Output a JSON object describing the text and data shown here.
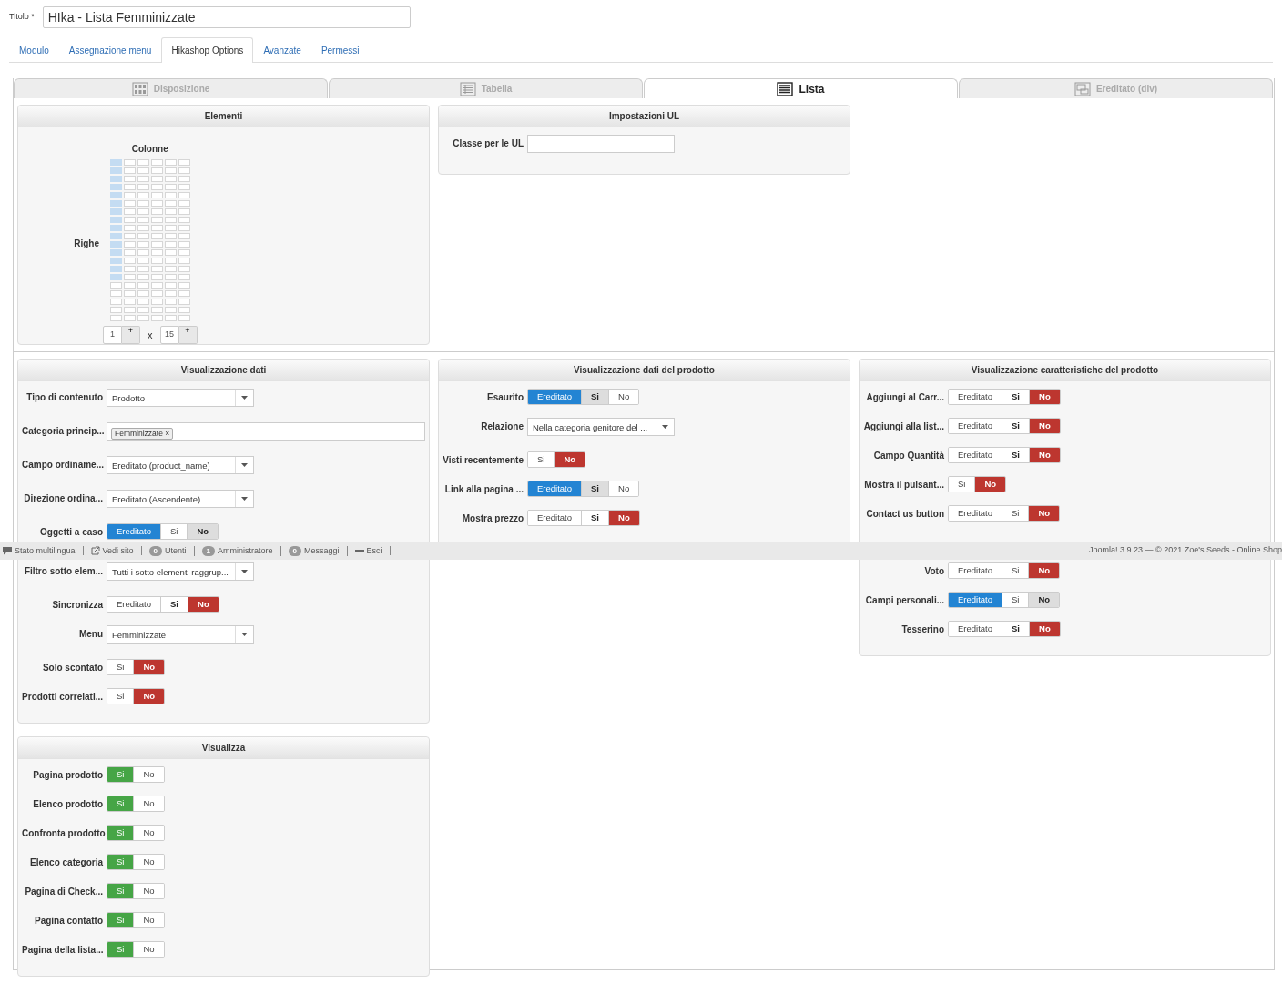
{
  "title_field": {
    "label": "Titolo *",
    "value": "HIka - Lista Femminizzate"
  },
  "tabs": [
    {
      "label": "Modulo",
      "selected": false
    },
    {
      "label": "Assegnazione menu",
      "selected": false
    },
    {
      "label": "Hikashop Options",
      "selected": true
    },
    {
      "label": "Avanzate",
      "selected": false
    },
    {
      "label": "Permessi",
      "selected": false
    }
  ],
  "layout_tabs": [
    {
      "label": "Disposizione",
      "kind": "grid",
      "selected": false
    },
    {
      "label": "Tabella",
      "kind": "table",
      "selected": false
    },
    {
      "label": "Lista",
      "kind": "list",
      "selected": true
    },
    {
      "label": "Ereditato (div)",
      "kind": "div",
      "selected": false
    }
  ],
  "elements_panel": {
    "title": "Elementi",
    "columns_label": "Colonne",
    "rows_label": "Righe",
    "columns": "1",
    "rows": "15",
    "times": "x",
    "increment": "+",
    "decrement": "–"
  },
  "ul_panel": {
    "title": "Impostazioni UL",
    "fields": [
      {
        "label": "Classe per le UL",
        "kind": "text"
      }
    ]
  },
  "data_panel": {
    "title": "Visualizzazione dati",
    "fields": [
      {
        "label": "Tipo di contenuto",
        "kind": "select",
        "value": "Prodotto"
      },
      {
        "label": "Categoria princip...",
        "kind": "tags",
        "tags": [
          {
            "label": "Femminizzate",
            "remove": "×"
          }
        ]
      },
      {
        "label": "Campo ordiname...",
        "kind": "select",
        "value": "Ereditato (product_name)"
      },
      {
        "label": "Direzione ordina...",
        "kind": "select",
        "value": "Ereditato (Ascendente)"
      },
      {
        "label": "Oggetti a caso",
        "kind": "toggle",
        "options": [
          {
            "label": "Ereditato",
            "kind": "inherit",
            "selected": true,
            "default": false
          },
          {
            "label": "Si",
            "kind": "yes",
            "selected": false,
            "default": false
          },
          {
            "label": "No",
            "kind": "no",
            "selected": false,
            "default": true
          }
        ]
      },
      {
        "label": "Filtro sotto elem...",
        "kind": "select",
        "value": "Tutti i sotto elementi raggrup..."
      },
      {
        "label": "Sincronizza",
        "kind": "toggle",
        "options": [
          {
            "label": "Ereditato",
            "kind": "inherit",
            "selected": false,
            "default": false
          },
          {
            "label": "Si",
            "kind": "yes",
            "selected": false,
            "default": true
          },
          {
            "label": "No",
            "kind": "no",
            "selected": true,
            "default": false
          }
        ]
      },
      {
        "label": "Menu",
        "kind": "select",
        "value": "Femminizzate"
      },
      {
        "label": "Solo scontato",
        "kind": "toggle",
        "options": [
          {
            "label": "Si",
            "kind": "yes",
            "selected": false,
            "default": false
          },
          {
            "label": "No",
            "kind": "no",
            "selected": true,
            "default": false
          }
        ]
      },
      {
        "label": "Prodotti correlati...",
        "kind": "toggle",
        "options": [
          {
            "label": "Si",
            "kind": "yes",
            "selected": false,
            "default": false
          },
          {
            "label": "No",
            "kind": "no",
            "selected": true,
            "default": false
          }
        ]
      }
    ]
  },
  "product_data_panel": {
    "title": "Visualizzazione dati del prodotto",
    "fields": [
      {
        "label": "Esaurito",
        "kind": "toggle",
        "options": [
          {
            "label": "Ereditato",
            "kind": "inherit",
            "selected": true,
            "default": false
          },
          {
            "label": "Si",
            "kind": "yes",
            "selected": false,
            "default": true
          },
          {
            "label": "No",
            "kind": "no",
            "selected": false,
            "default": false
          }
        ]
      },
      {
        "label": "Relazione",
        "kind": "select",
        "value": "Nella categoria genitore del ..."
      },
      {
        "label": "Visti recentemente",
        "kind": "toggle",
        "options": [
          {
            "label": "Si",
            "kind": "yes",
            "selected": false,
            "default": false
          },
          {
            "label": "No",
            "kind": "no",
            "selected": true,
            "default": false
          }
        ]
      },
      {
        "label": "Link alla pagina ...",
        "kind": "toggle",
        "options": [
          {
            "label": "Ereditato",
            "kind": "inherit",
            "selected": true,
            "default": false
          },
          {
            "label": "Si",
            "kind": "yes",
            "selected": false,
            "default": true
          },
          {
            "label": "No",
            "kind": "no",
            "selected": false,
            "default": false
          }
        ]
      },
      {
        "label": "Mostra prezzo",
        "kind": "toggle",
        "options": [
          {
            "label": "Ereditato",
            "kind": "inherit",
            "selected": false,
            "default": false
          },
          {
            "label": "Si",
            "kind": "yes",
            "selected": false,
            "default": true
          },
          {
            "label": "No",
            "kind": "no",
            "selected": true,
            "default": false
          }
        ]
      }
    ]
  },
  "features_panel": {
    "title": "Visualizzazione caratteristiche del prodotto",
    "fields": [
      {
        "label": "Aggiungi al Carr...",
        "kind": "toggle",
        "options": [
          {
            "label": "Ereditato",
            "kind": "inherit",
            "selected": false,
            "default": false
          },
          {
            "label": "Si",
            "kind": "yes",
            "selected": false,
            "default": true
          },
          {
            "label": "No",
            "kind": "no",
            "selected": true,
            "default": false
          }
        ]
      },
      {
        "label": "Aggiungi alla list...",
        "kind": "toggle",
        "options": [
          {
            "label": "Ereditato",
            "kind": "inherit",
            "selected": false,
            "default": false
          },
          {
            "label": "Si",
            "kind": "yes",
            "selected": false,
            "default": true
          },
          {
            "label": "No",
            "kind": "no",
            "selected": true,
            "default": false
          }
        ]
      },
      {
        "label": "Campo Quantità",
        "kind": "toggle",
        "options": [
          {
            "label": "Ereditato",
            "kind": "inherit",
            "selected": false,
            "default": false
          },
          {
            "label": "Si",
            "kind": "yes",
            "selected": false,
            "default": true
          },
          {
            "label": "No",
            "kind": "no",
            "selected": true,
            "default": false
          }
        ]
      },
      {
        "label": "Mostra il pulsant...",
        "kind": "toggle",
        "options": [
          {
            "label": "Si",
            "kind": "yes",
            "selected": false,
            "default": false
          },
          {
            "label": "No",
            "kind": "no",
            "selected": true,
            "default": false
          }
        ]
      },
      {
        "label": "Contact us button",
        "kind": "toggle",
        "options": [
          {
            "label": "Ereditato",
            "kind": "inherit",
            "selected": false,
            "default": false
          },
          {
            "label": "Si",
            "kind": "yes",
            "selected": false,
            "default": false
          },
          {
            "label": "No",
            "kind": "no",
            "selected": true,
            "default": false
          }
        ]
      },
      {
        "label": "Voto",
        "kind": "toggle",
        "options": [
          {
            "label": "Ereditato",
            "kind": "inherit",
            "selected": false,
            "default": false
          },
          {
            "label": "Si",
            "kind": "yes",
            "selected": false,
            "default": false
          },
          {
            "label": "No",
            "kind": "no",
            "selected": true,
            "default": false
          }
        ]
      },
      {
        "label": "Campi personali...",
        "kind": "toggle",
        "options": [
          {
            "label": "Ereditato",
            "kind": "inherit",
            "selected": true,
            "default": false
          },
          {
            "label": "Si",
            "kind": "yes",
            "selected": false,
            "default": false
          },
          {
            "label": "No",
            "kind": "no",
            "selected": false,
            "default": true
          }
        ]
      },
      {
        "label": "Tesserino",
        "kind": "toggle",
        "options": [
          {
            "label": "Ereditato",
            "kind": "inherit",
            "selected": false,
            "default": false
          },
          {
            "label": "Si",
            "kind": "yes",
            "selected": false,
            "default": true
          },
          {
            "label": "No",
            "kind": "no",
            "selected": true,
            "default": false
          }
        ]
      }
    ]
  },
  "display_panel": {
    "title": "Visualizza",
    "fields": [
      {
        "label": "Pagina prodotto",
        "kind": "toggle",
        "options": [
          {
            "label": "Si",
            "kind": "yes",
            "selected": true,
            "default": false
          },
          {
            "label": "No",
            "kind": "no",
            "selected": false,
            "default": false
          }
        ]
      },
      {
        "label": "Elenco prodotto",
        "kind": "toggle",
        "options": [
          {
            "label": "Si",
            "kind": "yes",
            "selected": true,
            "default": false
          },
          {
            "label": "No",
            "kind": "no",
            "selected": false,
            "default": false
          }
        ]
      },
      {
        "label": "Confronta prodotto",
        "kind": "toggle",
        "options": [
          {
            "label": "Si",
            "kind": "yes",
            "selected": true,
            "default": false
          },
          {
            "label": "No",
            "kind": "no",
            "selected": false,
            "default": false
          }
        ]
      },
      {
        "label": "Elenco categoria",
        "kind": "toggle",
        "options": [
          {
            "label": "Si",
            "kind": "yes",
            "selected": true,
            "default": false
          },
          {
            "label": "No",
            "kind": "no",
            "selected": false,
            "default": false
          }
        ]
      },
      {
        "label": "Pagina di Check...",
        "kind": "toggle",
        "options": [
          {
            "label": "Si",
            "kind": "yes",
            "selected": true,
            "default": false
          },
          {
            "label": "No",
            "kind": "no",
            "selected": false,
            "default": false
          }
        ]
      },
      {
        "label": "Pagina contatto",
        "kind": "toggle",
        "options": [
          {
            "label": "Si",
            "kind": "yes",
            "selected": true,
            "default": false
          },
          {
            "label": "No",
            "kind": "no",
            "selected": false,
            "default": false
          }
        ]
      },
      {
        "label": "Pagina della lista...",
        "kind": "toggle",
        "options": [
          {
            "label": "Si",
            "kind": "yes",
            "selected": true,
            "default": false
          },
          {
            "label": "No",
            "kind": "no",
            "selected": false,
            "default": false
          }
        ]
      }
    ]
  },
  "status_bar": {
    "items": [
      {
        "kind": "comment",
        "label": "Stato multilingua"
      },
      {
        "kind": "external",
        "label": "Vedi sito"
      },
      {
        "kind": "count",
        "count": "0",
        "label": "Utenti"
      },
      {
        "kind": "count",
        "count": "1",
        "label": "Amministratore"
      },
      {
        "kind": "count",
        "count": "0",
        "label": "Messaggi"
      },
      {
        "kind": "logout",
        "label": "Esci"
      }
    ],
    "copyright": "Joomla! 3.9.23 — © 2021 Zoe's Seeds - Online Shop"
  }
}
